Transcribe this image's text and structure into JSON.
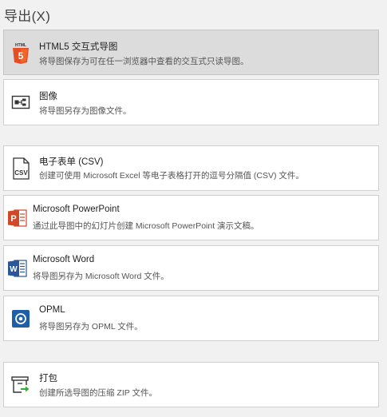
{
  "header": {
    "title": "导出(X)"
  },
  "items": [
    {
      "title": "HTML5 交互式导图",
      "desc": "将导图保存为可在任一浏览器中查看的交互式只读导图。",
      "icon": "html5-icon"
    },
    {
      "title": "图像",
      "desc": "将导图另存为图像文件。",
      "icon": "image-export-icon"
    },
    {
      "title": "电子表单 (CSV)",
      "desc": "创建可使用 Microsoft Excel 等电子表格打开的逗号分隔值 (CSV) 文件。",
      "icon": "csv-file-icon"
    },
    {
      "title": "Microsoft PowerPoint",
      "desc": "通过此导图中的幻灯片创建 Microsoft PowerPoint 演示文稿。",
      "icon": "powerpoint-icon"
    },
    {
      "title": "Microsoft Word",
      "desc": "将导图另存为 Microsoft Word 文件。",
      "icon": "word-icon"
    },
    {
      "title": "OPML",
      "desc": "将导图另存为 OPML 文件。",
      "icon": "opml-icon"
    },
    {
      "title": "打包",
      "desc": "创建所选导图的压缩 ZIP 文件。",
      "icon": "package-zip-icon"
    }
  ],
  "colors": {
    "html5": "#e44d26",
    "powerpoint": "#d24726",
    "word": "#2b579a",
    "opml": "#1f5fa8",
    "package_arrow": "#3aa63a"
  }
}
